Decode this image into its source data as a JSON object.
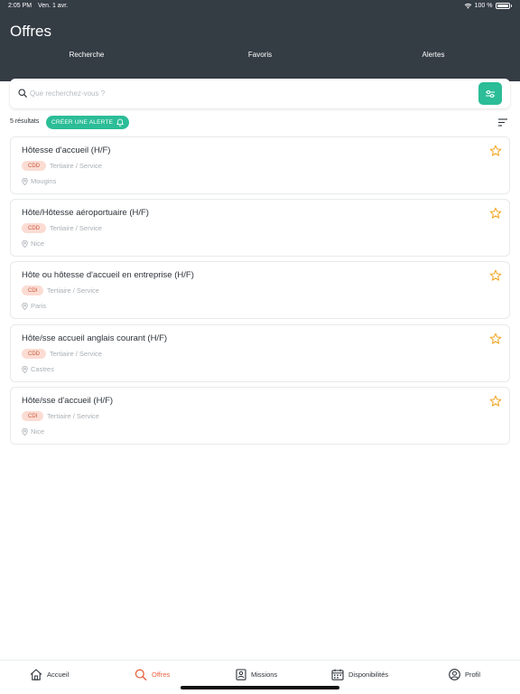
{
  "status_bar": {
    "time": "2:05 PM",
    "date": "Ven. 1 avr.",
    "battery": "100 %"
  },
  "header": {
    "title": "Offres"
  },
  "tabs": [
    {
      "label": "Recherche",
      "active": true
    },
    {
      "label": "Favoris",
      "active": false
    },
    {
      "label": "Alertes",
      "active": false
    }
  ],
  "search": {
    "placeholder": "Que recherchez-vous ?",
    "value": ""
  },
  "results": {
    "count_label": "5 résultats",
    "alert_button_label": "CRÉER UNE ALERTE"
  },
  "offers": [
    {
      "title": "Hôtesse d'accueil (H/F)",
      "contract": "CDD",
      "sector": "Tertiaire / Service",
      "location": "Mougins"
    },
    {
      "title": "Hôte/Hôtesse aéroportuaire (H/F)",
      "contract": "CDD",
      "sector": "Tertiaire / Service",
      "location": "Nice"
    },
    {
      "title": "Hôte ou hôtesse d'accueil en entreprise (H/F)",
      "contract": "CDI",
      "sector": "Tertiaire / Service",
      "location": "Paris"
    },
    {
      "title": "Hôte/sse accueil anglais courant (H/F)",
      "contract": "CDD",
      "sector": "Tertiaire / Service",
      "location": "Castres"
    },
    {
      "title": "Hôte/sse d'accueil (H/F)",
      "contract": "CDI",
      "sector": "Tertiaire / Service",
      "location": "Nice"
    }
  ],
  "bottom_nav": [
    {
      "label": "Accueil",
      "icon": "home-icon",
      "active": false
    },
    {
      "label": "Offres",
      "icon": "search-icon",
      "active": true
    },
    {
      "label": "Missions",
      "icon": "id-badge-icon",
      "active": false
    },
    {
      "label": "Disponibilités",
      "icon": "calendar-icon",
      "active": false
    },
    {
      "label": "Profil",
      "icon": "user-circle-icon",
      "active": false
    }
  ],
  "colors": {
    "header_bg": "#343c44",
    "accent_green": "#2bbd97",
    "star": "#f3a92a",
    "active_nav": "#e8623f",
    "badge_bg": "#fbdcd3",
    "badge_text": "#c8573b"
  }
}
